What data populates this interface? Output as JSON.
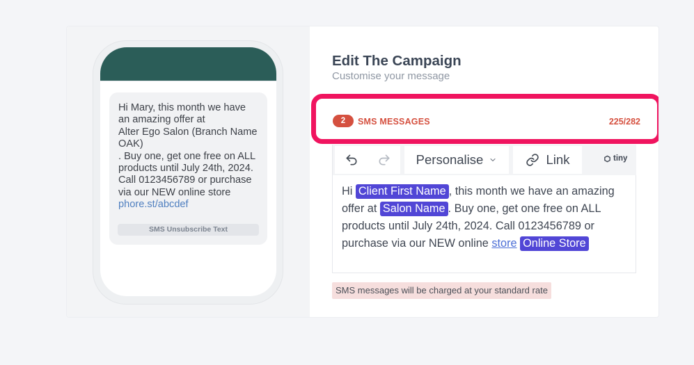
{
  "preview": {
    "message_part1": "Hi Mary, this month we have an amazing offer at",
    "salon": "Alter Ego Salon (Branch Name OAK)",
    "message_part2": ". Buy one, get one free on ALL products until July 24th, 2024. Call 0123456789 or purchase via our NEW online store",
    "link": "phore.st/abcdef",
    "unsubscribe": "SMS Unsubscribe Text"
  },
  "editor": {
    "title": "Edit The Campaign",
    "subtitle": "Customise your message",
    "sms_count": "2",
    "sms_label": "SMS MESSAGES",
    "char_count": "225/282",
    "toolbar": {
      "personalise": "Personalise",
      "link": "Link",
      "tiny": "tiny"
    },
    "content": {
      "t1": "Hi ",
      "tag1": "Client First Name",
      "t2": ", this month we have an amazing offer at ",
      "tag2": "Salon Name",
      "t3": ". Buy one, get one free on ALL products until July 24th, 2024. Call 0123456789 or purchase via our NEW online ",
      "link": "store",
      "t4": " ",
      "tag3": "Online Store"
    },
    "rate_note": "SMS messages will be charged at your standard rate"
  },
  "colors": {
    "phone_header": "#2b5d58",
    "highlight_border": "#f0145f",
    "sms_accent": "#d5503f",
    "chip": "#5146d6"
  }
}
